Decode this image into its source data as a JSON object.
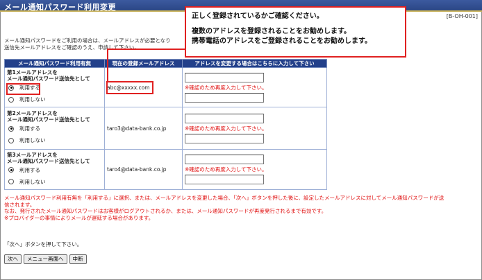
{
  "window": {
    "title": "メール通知パスワード利用変更",
    "screen_id": "[B-OH-001]"
  },
  "intro": {
    "line1": "メール通知パスワードをご利用の場合は、メールアドレスが必要となり",
    "line2": "送信先メールアドレスをご確認のうえ、申請して下さい。"
  },
  "table": {
    "headers": {
      "usage": "メール通知パスワード利用有無",
      "current": "現在の登録メールアドレス",
      "change": "アドレスを変更する場合はこちらに入力して下さい"
    },
    "rows": [
      {
        "title1": "第1メールアドレスを",
        "title2": "メール通知パスワード送信先として",
        "use_label": "利用する",
        "nouse_label": "利用しない",
        "selected": "use",
        "current_address": "abc@xxxxx.com",
        "input_value": "",
        "confirm_value": "",
        "confirm_note": "※確認のため再度入力して下さい。"
      },
      {
        "title1": "第2メールアドレスを",
        "title2": "メール通知パスワード送信先として",
        "use_label": "利用する",
        "nouse_label": "利用しない",
        "selected": "use",
        "current_address": "taro3@data-bank.co.jp",
        "input_value": "",
        "confirm_value": "",
        "confirm_note": "※確認のため再度入力して下さい。"
      },
      {
        "title1": "第3メールアドレスを",
        "title2": "メール通知パスワード送信先として",
        "use_label": "利用する",
        "nouse_label": "利用しない",
        "selected": "use",
        "current_address": "taro4@data-bank.co.jp",
        "input_value": "",
        "confirm_value": "",
        "confirm_note": "※確認のため再度入力して下さい。"
      }
    ]
  },
  "notes": {
    "line1": "メール通知パスワード利用有無を「利用する」に選択、または、メールアドレスを変更した場合、「次へ」ボタンを押した後に、設定したメールアドレスに対してメール通知パスワードが送",
    "line2": "信されます。",
    "line3": "なお、発行されたメール通知パスワードはお客様がログアウトされるか、または、メール通知パスワードが再度発行されるまで有効です。",
    "line4": "※プロバイダーの事情によりメールが遅延する場合があります。"
  },
  "instruction": "「次へ」ボタンを押して下さい。",
  "buttons": {
    "next": "次へ",
    "menu": "メニュー画面へ",
    "cancel": "中断"
  },
  "callout": {
    "line1": "正しく登録されているかご確認ください。",
    "line2": "複数のアドレスを登録されることをお勧めします。",
    "line3": "携帯電話のアドレスをご登録されることをお勧めします。"
  },
  "colors": {
    "title_bar": "#2b4786",
    "header_bg": "#23408a",
    "accent_red": "#e02020",
    "note_red": "#e01010"
  }
}
